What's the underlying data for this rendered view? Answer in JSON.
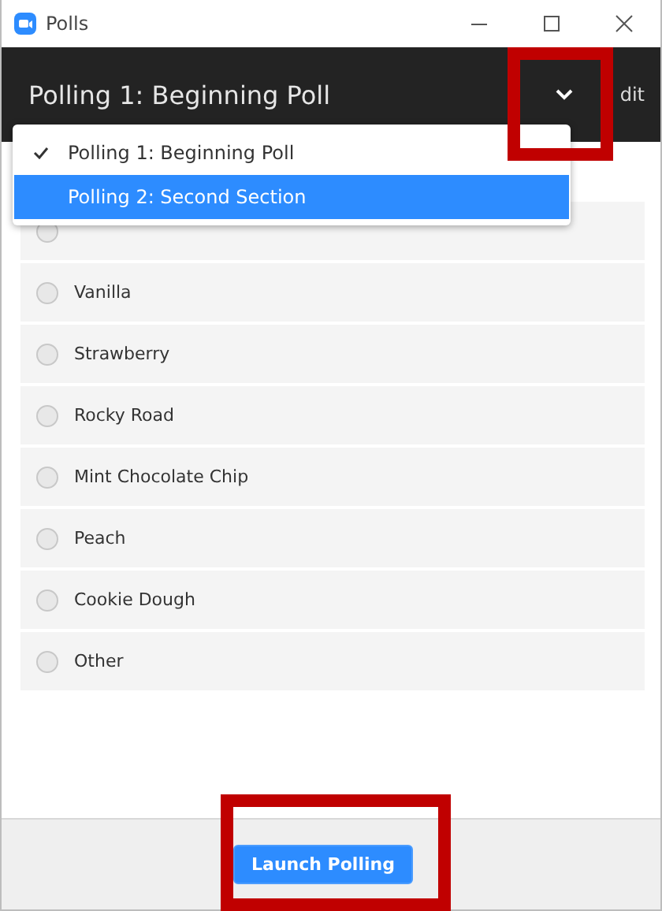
{
  "window": {
    "title": "Polls"
  },
  "header": {
    "title": "Polling 1: Beginning Poll",
    "edit": "dit"
  },
  "poll_menu": [
    {
      "label": "Polling 1: Beginning Poll",
      "checked": true,
      "highlighted": false
    },
    {
      "label": "Polling 2: Second Section",
      "checked": false,
      "highlighted": true
    }
  ],
  "options": [
    {
      "selected": false
    },
    {
      "label": "Vanilla",
      "selected": false
    },
    {
      "label": "Strawberry",
      "selected": false
    },
    {
      "label": "Rocky Road",
      "selected": false
    },
    {
      "label": "Mint Chocolate Chip",
      "selected": false
    },
    {
      "label": "Peach",
      "selected": false
    },
    {
      "label": "Cookie Dough",
      "selected": false
    },
    {
      "label": "Other",
      "selected": false
    }
  ],
  "footer": {
    "button": "Launch Polling"
  }
}
